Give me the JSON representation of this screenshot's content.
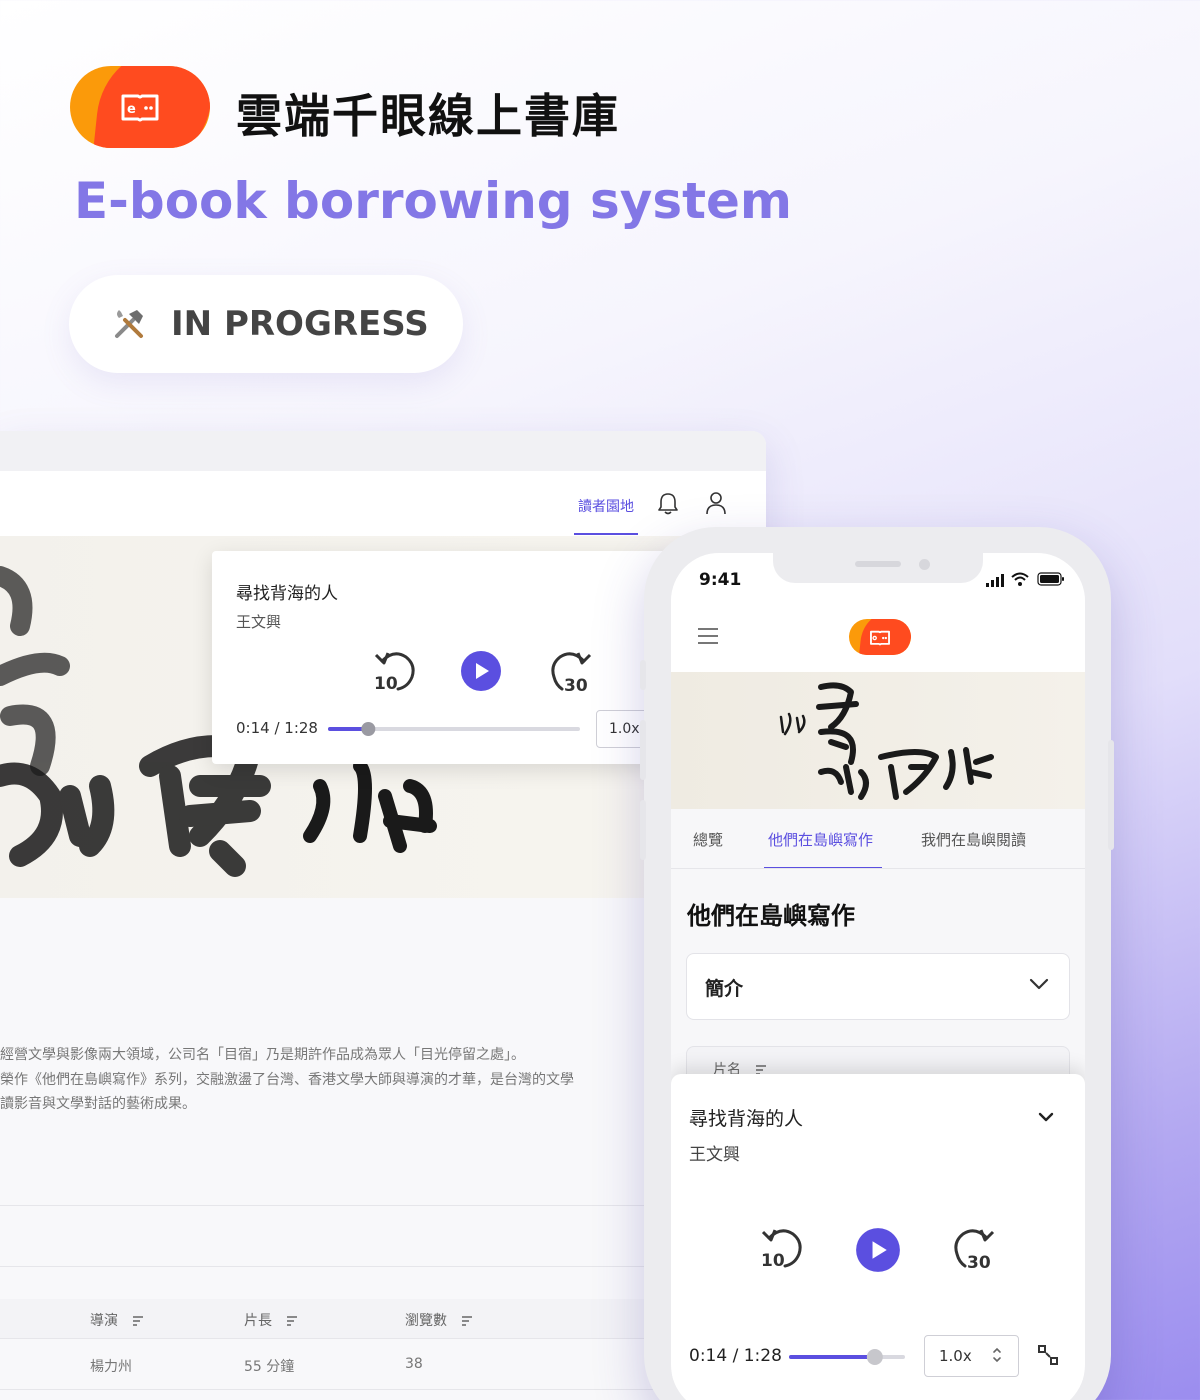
{
  "header": {
    "app_title": "雲端千眼線上書庫",
    "subtitle": "E-book borrowing system",
    "status_icon": "hammer-wrench-icon",
    "status_label": "IN PROGRESS"
  },
  "colors": {
    "accent": "#5b4fe0",
    "brand_orange": "#fb9a0a",
    "brand_red": "#ff4b1f",
    "subtitle_purple": "#8377e6"
  },
  "desktop": {
    "nav": {
      "active_tab": "讀者園地",
      "icons": [
        "bell-icon",
        "user-icon"
      ]
    },
    "player": {
      "title": "尋找背海的人",
      "author": "王文興",
      "current_time": "0:14",
      "duration": "1:28",
      "time_display": "0:14 / 1:28",
      "progress": 0.16,
      "speed": "1.0x",
      "controls": [
        "rewind-10-icon",
        "play-icon",
        "forward-30-icon"
      ]
    },
    "intro_lines": [
      "經營文學與影像兩大領域，公司名「目宿」乃是期許作品成為眾人「目光停留之處」。",
      "榮作《他們在島嶼寫作》系列，交融激盪了台灣、香港文學大師與導演的才華，是台灣的文學",
      "讀影音與文學對話的藝術成果。"
    ],
    "table": {
      "columns": [
        "導演",
        "片長",
        "瀏覽數"
      ],
      "rows": [
        [
          "楊力州",
          "55 分鐘",
          "38"
        ]
      ]
    }
  },
  "phone": {
    "time": "9:41",
    "status_icons": [
      "signal-icon",
      "wifi-icon",
      "battery-icon"
    ],
    "menu_icon": "hamburger-menu-icon",
    "tabs": [
      {
        "label": "總覽",
        "active": false
      },
      {
        "label": "他們在島嶼寫作",
        "active": true
      },
      {
        "label": "我們在島嶼閱讀",
        "active": false
      }
    ],
    "section_title": "他們在島嶼寫作",
    "accordion_label": "簡介",
    "table_column_peek": "片名",
    "player": {
      "title": "尋找背海的人",
      "author": "王文興",
      "time_display": "0:14 / 1:28",
      "progress": 0.74,
      "speed": "1.0x"
    }
  }
}
